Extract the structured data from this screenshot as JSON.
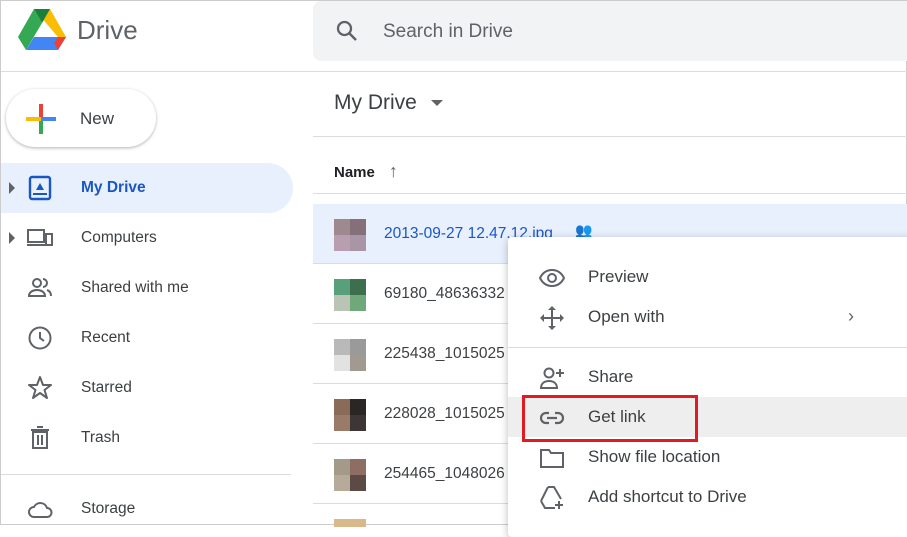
{
  "app": {
    "name": "Drive"
  },
  "search": {
    "placeholder": "Search in Drive"
  },
  "new_button": "New",
  "sidebar": {
    "items": [
      {
        "label": "My Drive",
        "icon": "my-drive-icon",
        "active": true
      },
      {
        "label": "Computers",
        "icon": "computers-icon"
      },
      {
        "label": "Shared with me",
        "icon": "shared-icon"
      },
      {
        "label": "Recent",
        "icon": "clock-icon"
      },
      {
        "label": "Starred",
        "icon": "star-icon"
      },
      {
        "label": "Trash",
        "icon": "trash-icon"
      }
    ],
    "storage": "Storage"
  },
  "main": {
    "title": "My Drive",
    "column_name": "Name",
    "files": [
      "2013-09-27 12.47.12.jpg",
      "69180_48636332",
      "225438_1015025",
      "228028_1015025",
      "254465_1048026"
    ]
  },
  "context_menu": {
    "items": [
      "Preview",
      "Open with",
      "Share",
      "Get link",
      "Show file location",
      "Add shortcut to Drive"
    ]
  },
  "colors": {
    "accent": "#1a56c4",
    "highlight": "#e01b24"
  }
}
